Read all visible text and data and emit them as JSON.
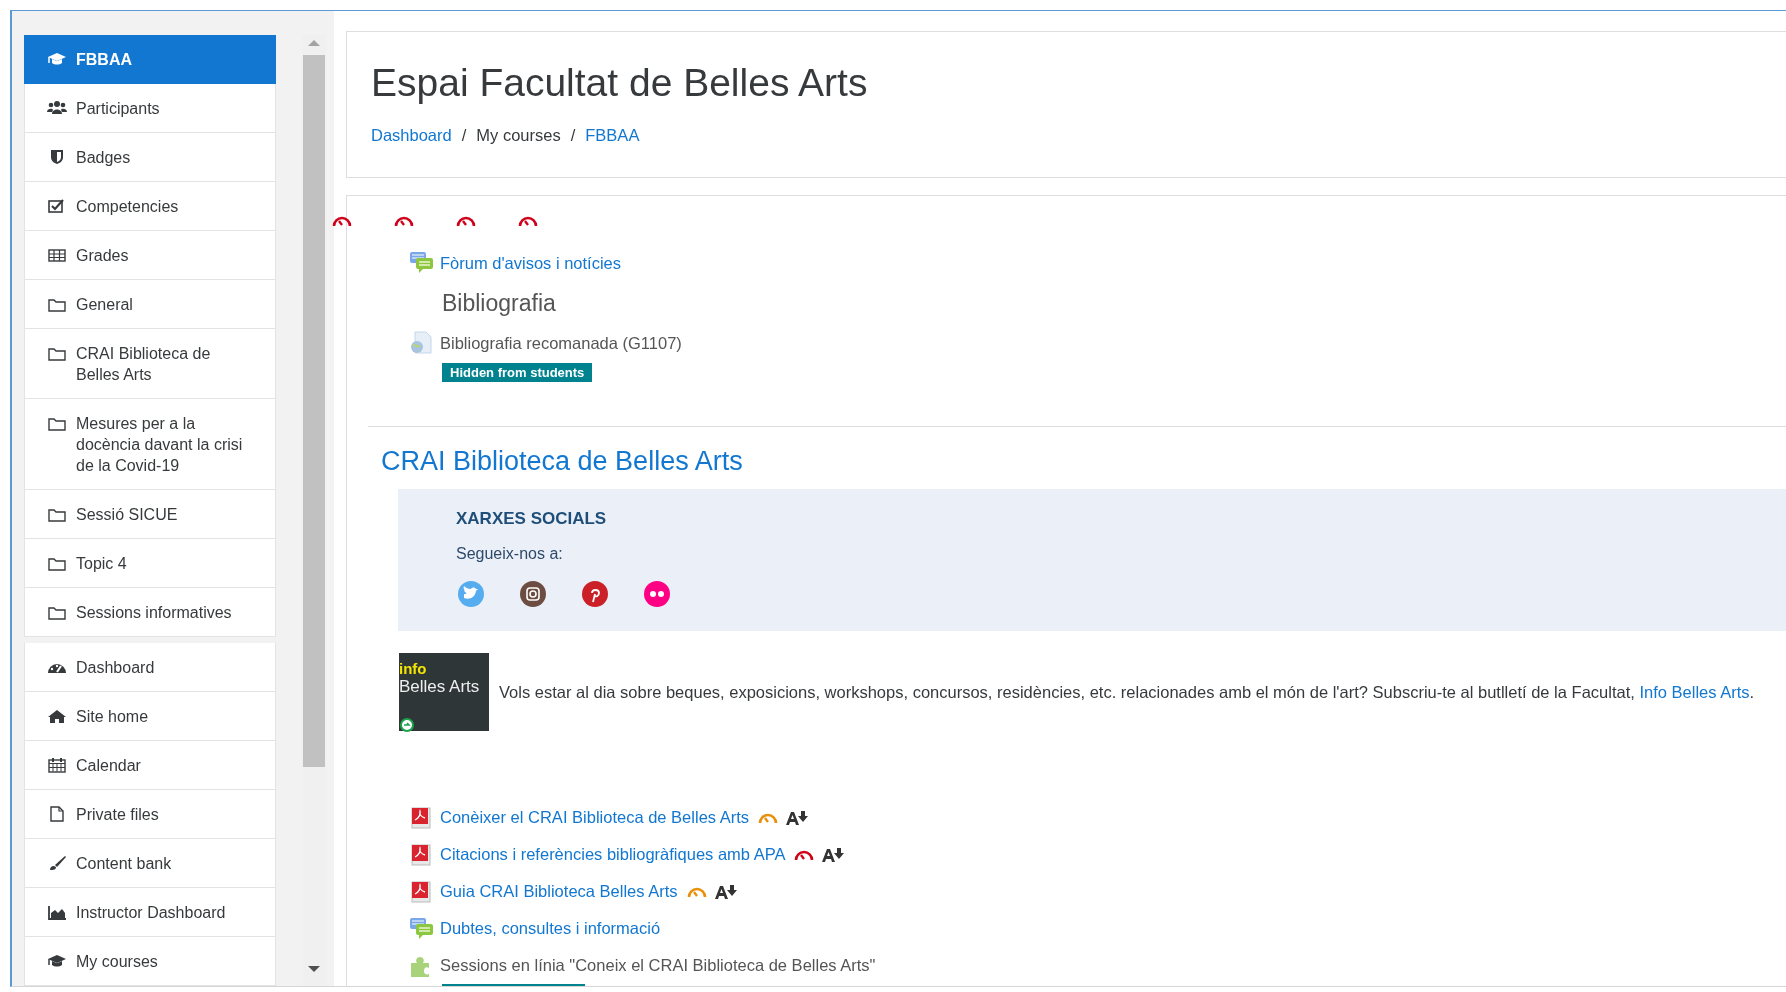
{
  "sidebar": {
    "groups": [
      [
        {
          "label": "FBBAA",
          "selected": true
        },
        {
          "label": "Participants",
          "selected": false
        },
        {
          "label": "Badges",
          "selected": false
        },
        {
          "label": "Competencies",
          "selected": false
        },
        {
          "label": "Grades",
          "selected": false
        },
        {
          "label": "General",
          "selected": false
        },
        {
          "label": "CRAI Biblioteca de Belles Arts",
          "selected": false
        },
        {
          "label": "Mesures per a la docència davant la crisi de la Covid-19",
          "selected": false
        },
        {
          "label": "Sessió SICUE",
          "selected": false
        },
        {
          "label": "Topic 4",
          "selected": false
        },
        {
          "label": "Sessions informatives",
          "selected": false
        }
      ],
      [
        {
          "label": "Dashboard",
          "selected": false
        },
        {
          "label": "Site home",
          "selected": false
        },
        {
          "label": "Calendar",
          "selected": false
        },
        {
          "label": "Private files",
          "selected": false
        },
        {
          "label": "Content bank",
          "selected": false
        },
        {
          "label": "Instructor Dashboard",
          "selected": false
        },
        {
          "label": "My courses",
          "selected": false
        }
      ]
    ]
  },
  "page_header": {
    "title": "Espai Facultat de Belles Arts",
    "separator": "/",
    "breadcrumb": [
      {
        "label": "Dashboard",
        "kind": "link"
      },
      {
        "label": "My courses",
        "kind": "text"
      },
      {
        "label": "FBBAA",
        "kind": "link"
      }
    ]
  },
  "sections": [
    {
      "activities": [
        {
          "kind": "forum",
          "label": "Fòrum d'avisos i notícies",
          "hidden": false
        },
        {
          "kind": "heading",
          "label": "Bibliografia",
          "hidden": false
        },
        {
          "kind": "url",
          "label": "Bibliografia recomanada (G1107)",
          "hidden": true,
          "badge": "Hidden from students"
        }
      ]
    },
    {
      "title": "CRAI Biblioteca de Belles Arts",
      "social": {
        "heading": "XARXES SOCIALS",
        "subtitle": "Segueix-nos a:"
      },
      "info": {
        "image_text_1": "info",
        "image_text_2": "Belles Arts",
        "text": "Vols estar al dia sobre beques, exposicions, workshops, concursos, residències, etc. relacionades amb el món de l'art? Subscriu-te al butlletí de la Facultat, ",
        "link": "Info Belles Arts",
        "after": "."
      },
      "activities": [
        {
          "kind": "pdf",
          "label": "Conèixer el CRAI Biblioteca de Belles Arts",
          "color": "#e8900c",
          "hidden": false
        },
        {
          "kind": "pdf",
          "label": "Citacions i referències bibliogràfiques amb APA",
          "color": "#d0021b",
          "hidden": false
        },
        {
          "kind": "pdf",
          "label": "Guia CRAI Biblioteca Belles Arts",
          "color": "#e8900c",
          "hidden": false
        },
        {
          "kind": "forum",
          "label": "Dubtes, consultes i informació",
          "hidden": false
        },
        {
          "kind": "page",
          "label": "Sessions en línia \"Coneix el CRAI Biblioteca de Belles Arts\"",
          "hidden": true
        }
      ]
    }
  ]
}
